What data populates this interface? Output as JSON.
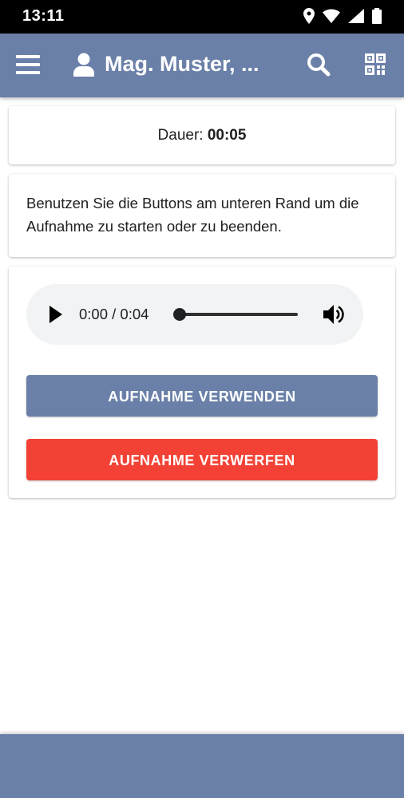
{
  "status_bar": {
    "time": "13:11",
    "icons": [
      "location-icon",
      "wifi-icon",
      "signal-icon",
      "battery-icon"
    ]
  },
  "app_bar": {
    "title": "Mag. Muster, ...",
    "icons": [
      "menu-icon",
      "user-icon",
      "search-icon",
      "qr-code-icon"
    ],
    "color": "#6a80a8"
  },
  "duration": {
    "label": "Dauer:",
    "value": "00:05"
  },
  "info": {
    "text": "Benutzen Sie die Buttons am unteren Rand um die Aufnahme zu starten oder zu beenden."
  },
  "player": {
    "time": "0:00 / 0:04",
    "progress": 0
  },
  "buttons": {
    "use_label": "AUFNAHME VERWENDEN",
    "discard_label": "AUFNAHME VERWERFEN",
    "use_color": "#6a80a8",
    "discard_color": "#f34235"
  }
}
